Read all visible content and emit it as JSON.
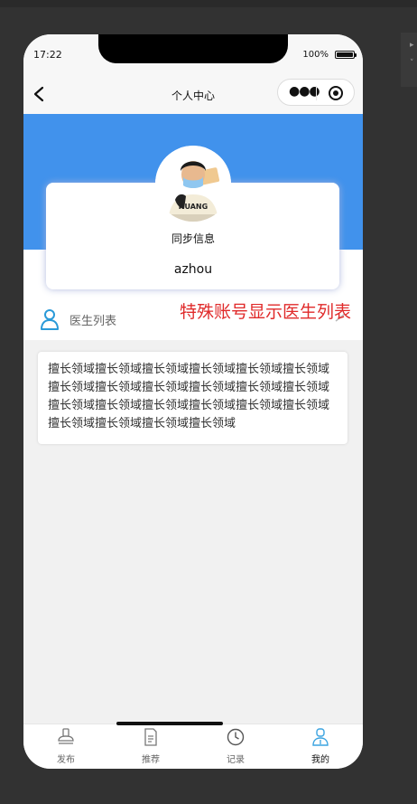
{
  "status": {
    "time": "17:22",
    "battery": "100%",
    "battery_level": 1.0
  },
  "navbar": {
    "title": "个人中心"
  },
  "profile": {
    "sync_label": "同步信息",
    "username": "azhou",
    "avatar_badge": "HUANG"
  },
  "doctor_list": {
    "label": "医生列表"
  },
  "annotation": "特殊账号显示医生列表",
  "specialty_text": "擅长领域擅长领域擅长领域擅长领域擅长领域擅长领域擅长领域擅长领域擅长领域擅长领域擅长领域擅长领域擅长领域擅长领域擅长领域擅长领域擅长领域擅长领域擅长领域擅长领域擅长领域擅长领域",
  "tabbar": {
    "items": [
      {
        "label": "发布",
        "icon": "publish-icon"
      },
      {
        "label": "推荐",
        "icon": "document-icon"
      },
      {
        "label": "记录",
        "icon": "clock-icon"
      },
      {
        "label": "我的",
        "icon": "doctor-icon"
      }
    ],
    "active_index": 3
  },
  "colors": {
    "banner": "#4192ec",
    "annotation": "#e02a2a",
    "active_tab": "#3aa3e0"
  }
}
